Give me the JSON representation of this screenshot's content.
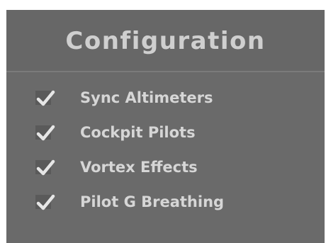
{
  "panel": {
    "title": "Configuration"
  },
  "options": [
    {
      "label": "Sync Altimeters",
      "checked": true
    },
    {
      "label": "Cockpit Pilots",
      "checked": true
    },
    {
      "label": "Vortex Effects",
      "checked": true
    },
    {
      "label": "Pilot G Breathing",
      "checked": true
    }
  ],
  "colors": {
    "panel_background": "#6a6a6a",
    "title_text": "#cfcfcf",
    "label_text": "#d6d6d6",
    "checkbox_box": "#5a5a5a",
    "checkmark": "#e6e6e6"
  },
  "icons": {
    "check": "checkmark-icon"
  }
}
